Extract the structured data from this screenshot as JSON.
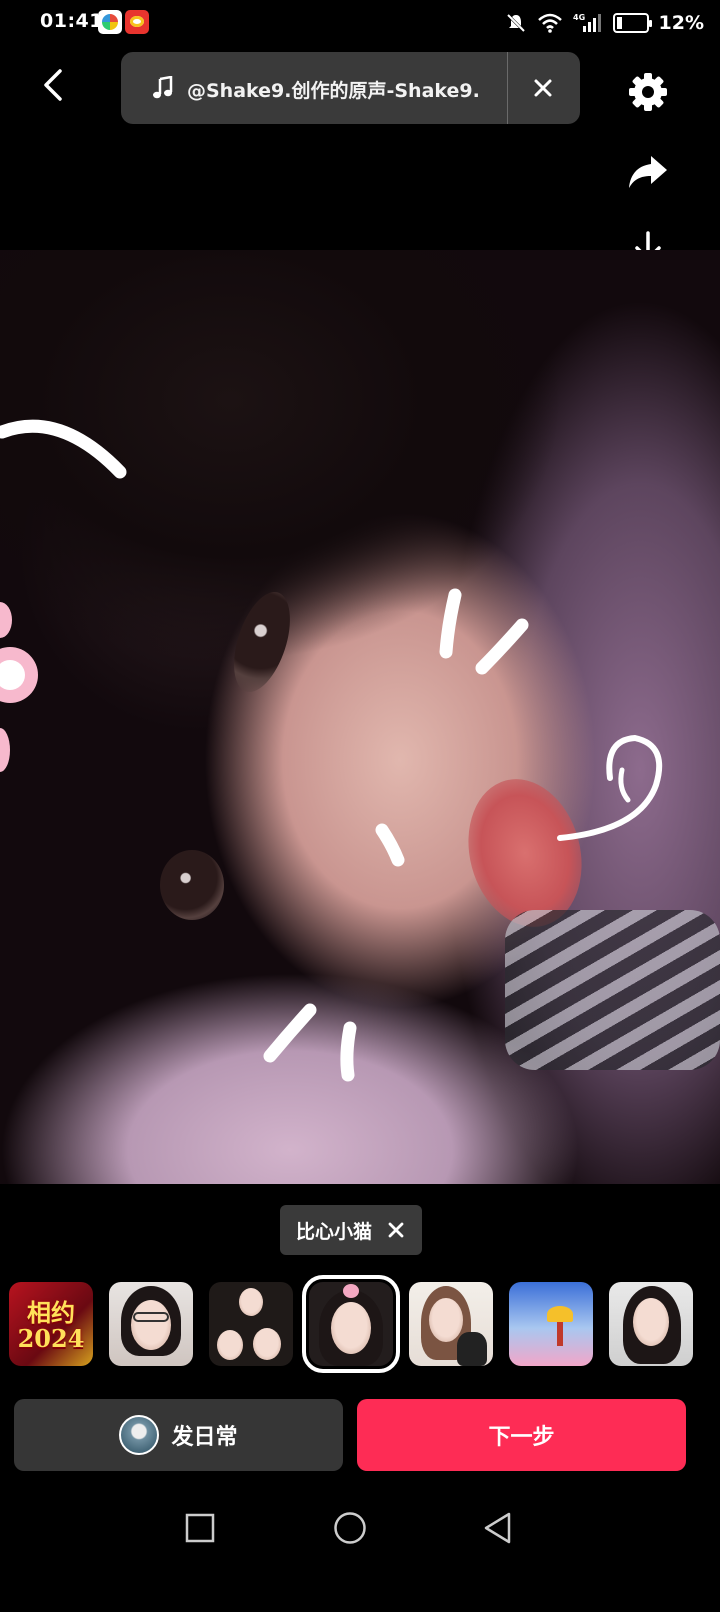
{
  "status_bar": {
    "time": "01:41",
    "battery_pct": "12%",
    "network": "4G"
  },
  "top_bar": {
    "music_label": "@Shake9.创作的原声-Shake9."
  },
  "right_rail": {
    "icons": [
      "settings-icon",
      "share-icon",
      "download-icon",
      "text-icon",
      "sticker-add-icon",
      "sticker-icon",
      "effects-icon",
      "expand-icon"
    ]
  },
  "filter_chip": {
    "label": "比心小猫"
  },
  "effects": {
    "selected_index": 3,
    "items": [
      {
        "label": "相约\n2024"
      },
      {
        "label": ""
      },
      {
        "label": ""
      },
      {
        "label": ""
      },
      {
        "label": ""
      },
      {
        "label": ""
      },
      {
        "label": ""
      }
    ]
  },
  "bottom": {
    "daily_label": "发日常",
    "next_label": "下一步"
  },
  "colors": {
    "accent": "#fe2c55",
    "panel": "#363636",
    "background": "#000000"
  }
}
